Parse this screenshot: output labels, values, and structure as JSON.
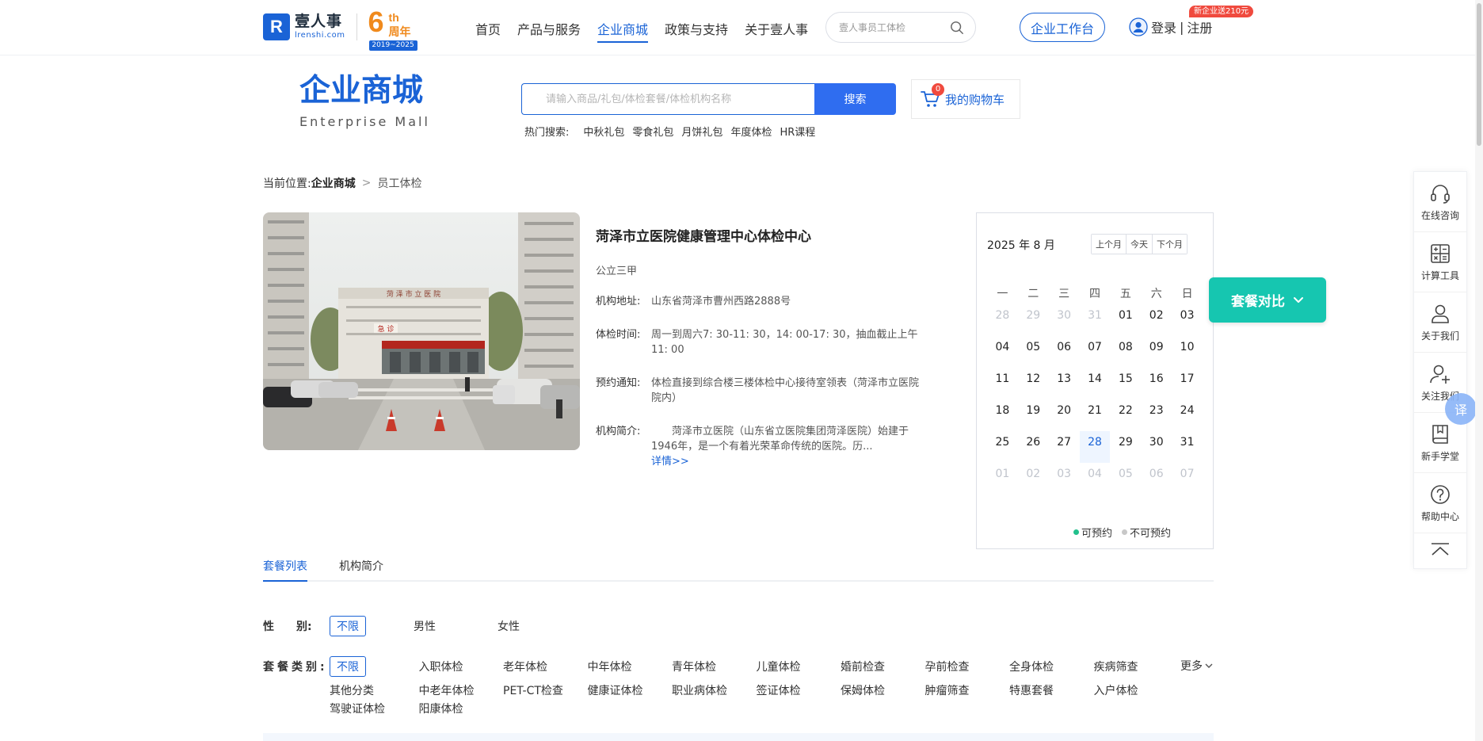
{
  "brand": {
    "logo_cn": "壹人事",
    "logo_en": "lrenshi.com",
    "anniv_num": "6",
    "anniv_th": "th",
    "anniv_text": "周年",
    "anniv_years": "2019~2025"
  },
  "nav": {
    "items": [
      "首页",
      "产品与服务",
      "企业商城",
      "政策与支持",
      "关于壹人事"
    ],
    "active_index": 2
  },
  "top_search": {
    "placeholder": "壹人事员工体检"
  },
  "workbench_label": "企业工作台",
  "login_label": "登录",
  "login_sep": "|",
  "register_label": "注册",
  "promo_badge": "新企业送210元",
  "mall": {
    "title": "企业商城",
    "subtitle": "Enterprise  Mall",
    "search_placeholder": "请输入商品/礼包/体检套餐/体检机构名称",
    "search_button": "搜索",
    "hot_label": "热门搜索:",
    "hot_items": [
      "中秋礼包",
      "零食礼包",
      "月饼礼包",
      "年度体检",
      "HR课程"
    ],
    "cart_count": "0",
    "cart_label": "我的购物车"
  },
  "breadcrumb": {
    "prefix": "当前位置:",
    "level1": "企业商城",
    "sep": ">",
    "level2": "员工体检"
  },
  "hospital": {
    "name": "菏泽市立医院健康管理中心体检中心",
    "level": "公立三甲",
    "address_label": "机构地址:",
    "address": "山东省菏泽市曹州西路2888号",
    "time_label": "体检时间:",
    "time": "周一到周六7: 30-11: 30，14: 00-17: 30，抽血截止上午11: 00",
    "notice_label": "预约通知:",
    "notice": "体检直接到综合楼三楼体检中心接待室领表（菏泽市立医院院内）",
    "intro_label": "机构简介:",
    "intro": "　　菏泽市立医院（山东省立医院集团菏泽医院）始建于1946年，是一个有着光荣革命传统的医院。历...",
    "detail_link": "详情>>",
    "photo_sign": "菏 泽 市 立 医 院",
    "photo_gate": "急 诊"
  },
  "calendar": {
    "title": "2025 年 8 月",
    "prev": "上个月",
    "today": "今天",
    "next": "下个月",
    "weekdays": [
      "一",
      "二",
      "三",
      "四",
      "五",
      "六",
      "日"
    ],
    "days": [
      {
        "d": "28",
        "muted": true
      },
      {
        "d": "29",
        "muted": true
      },
      {
        "d": "30",
        "muted": true
      },
      {
        "d": "31",
        "muted": true
      },
      {
        "d": "01"
      },
      {
        "d": "02"
      },
      {
        "d": "03"
      },
      {
        "d": "04"
      },
      {
        "d": "05"
      },
      {
        "d": "06"
      },
      {
        "d": "07"
      },
      {
        "d": "08"
      },
      {
        "d": "09"
      },
      {
        "d": "10"
      },
      {
        "d": "11"
      },
      {
        "d": "12"
      },
      {
        "d": "13"
      },
      {
        "d": "14"
      },
      {
        "d": "15"
      },
      {
        "d": "16"
      },
      {
        "d": "17"
      },
      {
        "d": "18"
      },
      {
        "d": "19"
      },
      {
        "d": "20"
      },
      {
        "d": "21"
      },
      {
        "d": "22"
      },
      {
        "d": "23"
      },
      {
        "d": "24"
      },
      {
        "d": "25"
      },
      {
        "d": "26"
      },
      {
        "d": "27"
      },
      {
        "d": "28",
        "today": true
      },
      {
        "d": "29"
      },
      {
        "d": "30"
      },
      {
        "d": "31"
      },
      {
        "d": "01",
        "muted": true
      },
      {
        "d": "02",
        "muted": true
      },
      {
        "d": "03",
        "muted": true
      },
      {
        "d": "04",
        "muted": true
      },
      {
        "d": "05",
        "muted": true
      },
      {
        "d": "06",
        "muted": true
      },
      {
        "d": "07",
        "muted": true
      }
    ],
    "legend_available": "可预约",
    "legend_unavailable": "不可预约",
    "available_color": "#22c08c",
    "unavailable_color": "#c8c8c8"
  },
  "compare_label": "套餐对比",
  "sidebar": {
    "items": [
      {
        "label": "在线咨询",
        "icon": "headset-icon"
      },
      {
        "label": "计算工具",
        "icon": "calculator-icon"
      },
      {
        "label": "关于我们",
        "icon": "user-icon"
      },
      {
        "label": "关注我们",
        "icon": "user-plus-icon"
      },
      {
        "label": "新手学堂",
        "icon": "book-icon"
      },
      {
        "label": "帮助中心",
        "icon": "help-icon"
      }
    ]
  },
  "translate_label": "译",
  "tabs": [
    "套餐列表",
    "机构简介"
  ],
  "filters": {
    "gender_label": "性　　别:",
    "gender_options": [
      "不限",
      "男性",
      "女性"
    ],
    "type_label": "套餐类别:",
    "type_options": [
      "不限",
      "入职体检",
      "老年体检",
      "中年体检",
      "青年体检",
      "儿童体检",
      "婚前检查",
      "孕前检查",
      "全身体检",
      "疾病筛查",
      "其他分类",
      "中老年体检",
      "PET-CT检查",
      "健康证体检",
      "职业病体检",
      "签证体检",
      "保姆体检",
      "肿瘤筛查",
      "特惠套餐",
      "入户体检",
      "驾驶证体检",
      "阳康体检"
    ],
    "more_label": "更多"
  },
  "colors": {
    "primary": "#1a63d6",
    "accent_teal": "#16c6b0",
    "badge_red": "#f04a3e",
    "anniv_orange": "#f08a1d"
  }
}
